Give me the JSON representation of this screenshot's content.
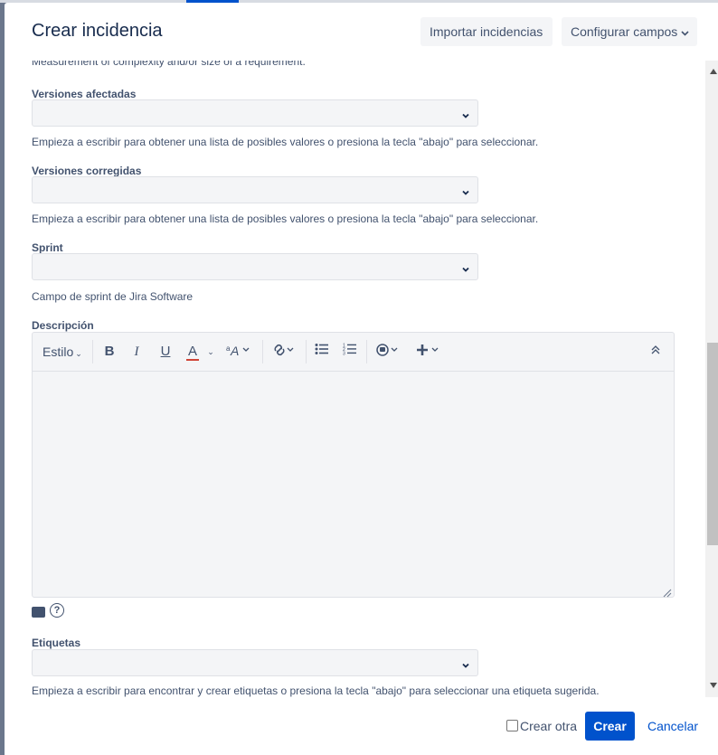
{
  "dialog": {
    "title": "Crear incidencia",
    "import_label": "Importar incidencias",
    "config_label": "Configurar campos",
    "config_icon": "chevron-down-icon"
  },
  "fields": {
    "cut_text": "Measurement of complexity and/or size of a requirement.",
    "affected": {
      "label": "Versiones afectadas",
      "value": "",
      "help": "Empieza a escribir para obtener una lista de posibles valores o presiona la tecla \"abajo\" para seleccionar."
    },
    "fixed": {
      "label": "Versiones corregidas",
      "value": "",
      "help": "Empieza a escribir para obtener una lista de posibles valores o presiona la tecla \"abajo\" para seleccionar."
    },
    "sprint": {
      "label": "Sprint",
      "value": "",
      "help": "Campo de sprint de Jira Software"
    },
    "description": {
      "label": "Descripción",
      "value": ""
    },
    "labels": {
      "label": "Etiquetas",
      "value": "",
      "help": "Empieza a escribir para encontrar y crear etiquetas o presiona la tecla \"abajo\" para seleccionar una etiqueta sugerida."
    }
  },
  "toolbar": {
    "style_label": "Estilo",
    "bold": "B",
    "italic": "I",
    "underline": "U",
    "text_color": "A",
    "icons": [
      "bold-icon",
      "italic-icon",
      "underline-icon",
      "text-color-icon",
      "text-format-icon",
      "link-icon",
      "bullet-list-icon",
      "numbered-list-icon",
      "emoji-icon",
      "insert-plus-icon",
      "collapse-icon"
    ]
  },
  "footer": {
    "create_another_label": "Crear otra",
    "create_another_checked": false,
    "create_label": "Crear",
    "cancel_label": "Cancelar"
  },
  "colors": {
    "primary": "#0052cc",
    "field_bg": "#f4f5f7",
    "text": "#172b4d",
    "muted": "#42526e",
    "text_color_bar": "#d04437"
  }
}
